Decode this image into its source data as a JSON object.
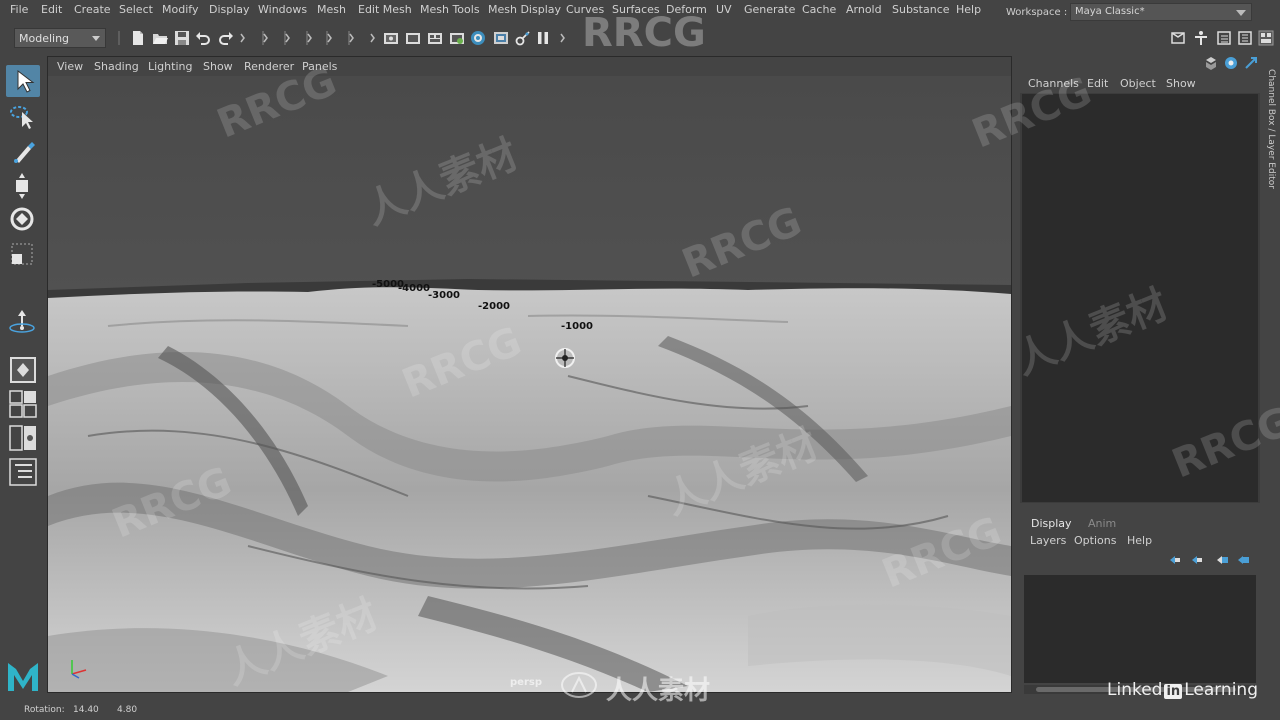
{
  "menubar": {
    "items": [
      "File",
      "Edit",
      "Create",
      "Select",
      "Modify",
      "Display",
      "Windows",
      "Mesh",
      "Edit Mesh",
      "Mesh Tools",
      "Mesh Display",
      "Curves",
      "Surfaces",
      "Deform",
      "UV",
      "Generate",
      "Cache",
      "Arnold",
      "Substance",
      "Help"
    ],
    "workspace_label": "Workspace :",
    "workspace_value": "Maya Classic*"
  },
  "statusline": {
    "mode": "Modeling"
  },
  "toolbox": {
    "tools": [
      "select-tool-icon",
      "lasso-tool-icon",
      "paint-select-icon",
      "move-tool-icon",
      "rotate-tool-icon",
      "scale-tool-icon",
      "soft-mod-icon",
      "single-perspective-icon",
      "four-view-icon",
      "two-view-icon",
      "outliner-icon"
    ],
    "active": "select-tool-icon"
  },
  "viewport": {
    "menu": [
      "View",
      "Shading",
      "Lighting",
      "Show",
      "Renderer",
      "Panels"
    ],
    "camera": "persp",
    "grid_labels": [
      "-5000",
      "-4000",
      "-3000",
      "-2000",
      "-1000"
    ]
  },
  "channelbox": {
    "menu": [
      "Channels",
      "Edit",
      "Object",
      "Show"
    ],
    "side_tab": "Channel Box / Layer Editor"
  },
  "layereditor": {
    "tabs": [
      "Display",
      "Anim"
    ],
    "active_tab": "Display",
    "menu": [
      "Layers",
      "Options",
      "Help"
    ]
  },
  "helpline": {
    "label": "Rotation:",
    "value1": "14.40",
    "value2": "4.80"
  },
  "watermark": {
    "rrcg": "RRCG",
    "cn": "人人素材",
    "brand_a": "Linked",
    "brand_in": "in",
    "brand_b": "Learning"
  },
  "colors": {
    "accent": "#5285a6",
    "panel": "#444444",
    "dark": "#2b2b2b"
  }
}
